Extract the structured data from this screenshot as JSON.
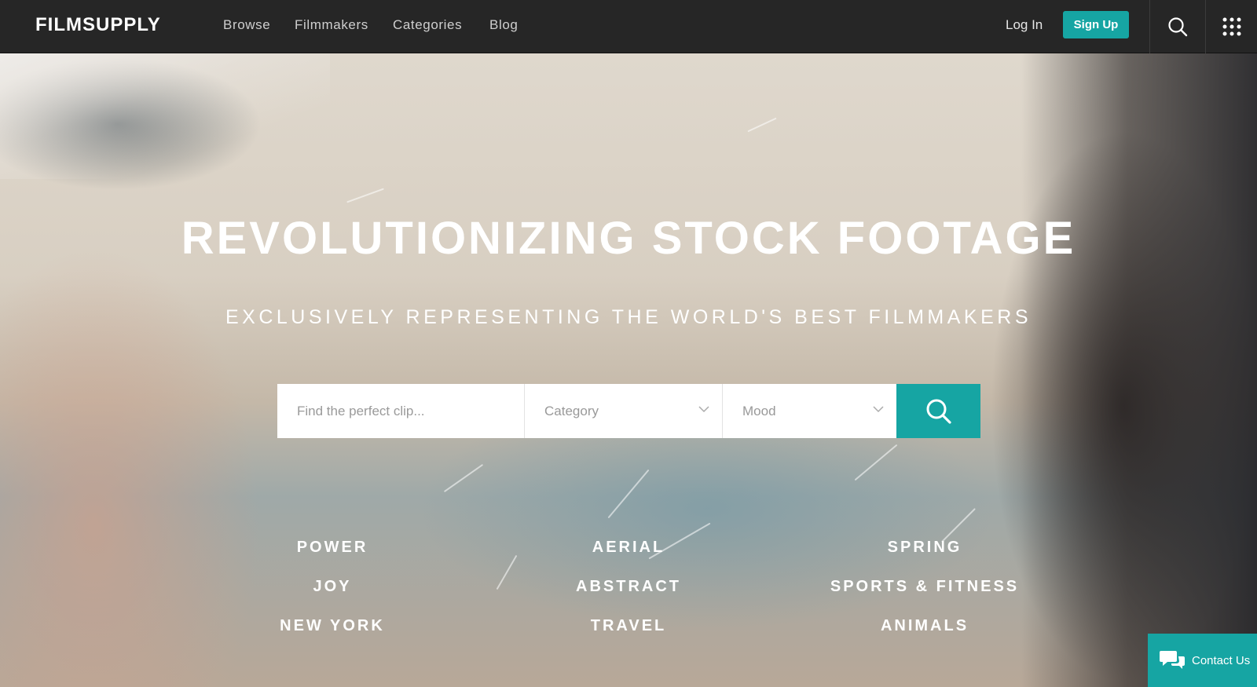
{
  "nav": {
    "logo": "FILMSUPPLY",
    "links": [
      "Browse",
      "Filmmakers",
      "Categories",
      "Blog"
    ],
    "login": "Log In",
    "signup": "Sign Up"
  },
  "hero": {
    "headline": "REVOLUTIONIZING STOCK FOOTAGE",
    "subhead": "EXCLUSIVELY REPRESENTING THE WORLD'S BEST FILMMAKERS"
  },
  "search": {
    "placeholder": "Find the perfect clip...",
    "category": "Category",
    "mood": "Mood"
  },
  "categories": {
    "col1": [
      "POWER",
      "JOY",
      "NEW YORK"
    ],
    "col2": [
      "AERIAL",
      "ABSTRACT",
      "TRAVEL"
    ],
    "col3": [
      "SPRING",
      "SPORTS & FITNESS",
      "ANIMALS"
    ]
  },
  "contact": {
    "label": "Contact Us"
  },
  "colors": {
    "accent": "#16a5a3",
    "nav_bg": "#262626"
  }
}
